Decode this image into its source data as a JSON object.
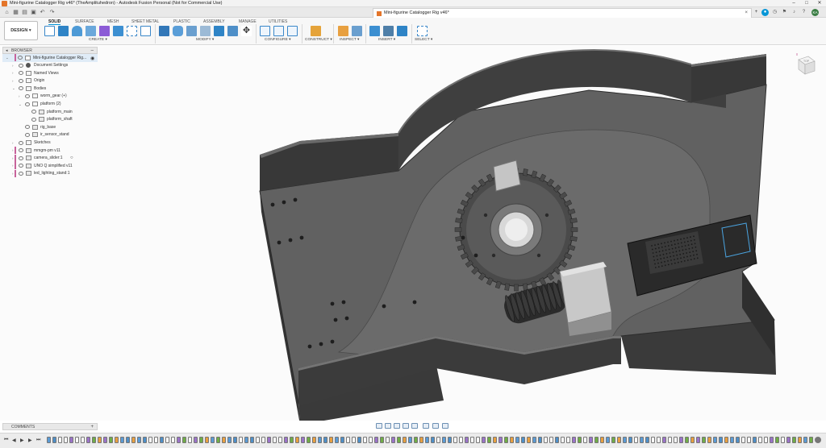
{
  "window": {
    "title": "Mini-figurine Catalogger Rig v46* (TheAmplituhedron) - Autodesk Fusion Personal (Not for Commercial Use)",
    "controls": [
      "–",
      "□",
      "✕"
    ]
  },
  "tabbar": {
    "doc_tab_label": "Mini-figurine Catalogger Rig v46*",
    "close_glyph": "×",
    "plus_glyph": "+",
    "user_initials": "KA"
  },
  "ribbon": {
    "workspace_button": "DESIGN",
    "tabs": [
      "SOLID",
      "SURFACE",
      "MESH",
      "SHEET METAL",
      "PLASTIC",
      "ASSEMBLY",
      "MANAGE",
      "UTILITIES"
    ],
    "active_tab": "SOLID",
    "groups": [
      "CREATE",
      "MODIFY",
      "CONFIGURE",
      "CONSTRUCT",
      "INSPECT",
      "INSERT",
      "SELECT"
    ]
  },
  "browser": {
    "header": "BROWSER",
    "root": "Mini-figurine Catalogger Rig...",
    "items": [
      {
        "label": "Document Settings",
        "level": 1,
        "icon": "gear",
        "arrow": "›"
      },
      {
        "label": "Named Views",
        "level": 1,
        "icon": "folder",
        "arrow": "›"
      },
      {
        "label": "Origin",
        "level": 1,
        "icon": "folder",
        "arrow": "›"
      },
      {
        "label": "Bodies",
        "level": 1,
        "icon": "folder",
        "arrow": "⌄"
      },
      {
        "label": "worm_gear (+)",
        "level": 2,
        "icon": "folder",
        "arrow": "›"
      },
      {
        "label": "platform (2)",
        "level": 2,
        "icon": "folder",
        "arrow": "⌄"
      },
      {
        "label": "platform_main",
        "level": 3,
        "icon": "body",
        "arrow": ""
      },
      {
        "label": "platform_shaft",
        "level": 3,
        "icon": "body",
        "arrow": ""
      },
      {
        "label": "rig_base",
        "level": 2,
        "icon": "body",
        "arrow": ""
      },
      {
        "label": "ir_sensor_stand",
        "level": 2,
        "icon": "body",
        "arrow": ""
      },
      {
        "label": "Sketches",
        "level": 1,
        "icon": "folder",
        "arrow": "›"
      },
      {
        "label": "mmgm-pm v11",
        "level": 1,
        "icon": "body",
        "arrow": "›"
      },
      {
        "label": "camera_slider:1",
        "level": 1,
        "icon": "body",
        "arrow": "›"
      },
      {
        "label": "UNO Q simplified v11",
        "level": 1,
        "icon": "body",
        "arrow": "›"
      },
      {
        "label": "led_lighting_stand:1",
        "level": 1,
        "icon": "body",
        "arrow": "›"
      }
    ]
  },
  "viewcube": {
    "face": "TOP"
  },
  "comments": {
    "header": "COMMENTS",
    "plus": "+"
  },
  "timeline": {
    "controls": [
      "⏮",
      "◀",
      "▶",
      "▶",
      "⏭"
    ]
  },
  "colors": {
    "accent": "#0696d7",
    "model_top": "#5f5f5f",
    "model_side": "#3c3c3c",
    "canvas": "#fbfbfb"
  }
}
